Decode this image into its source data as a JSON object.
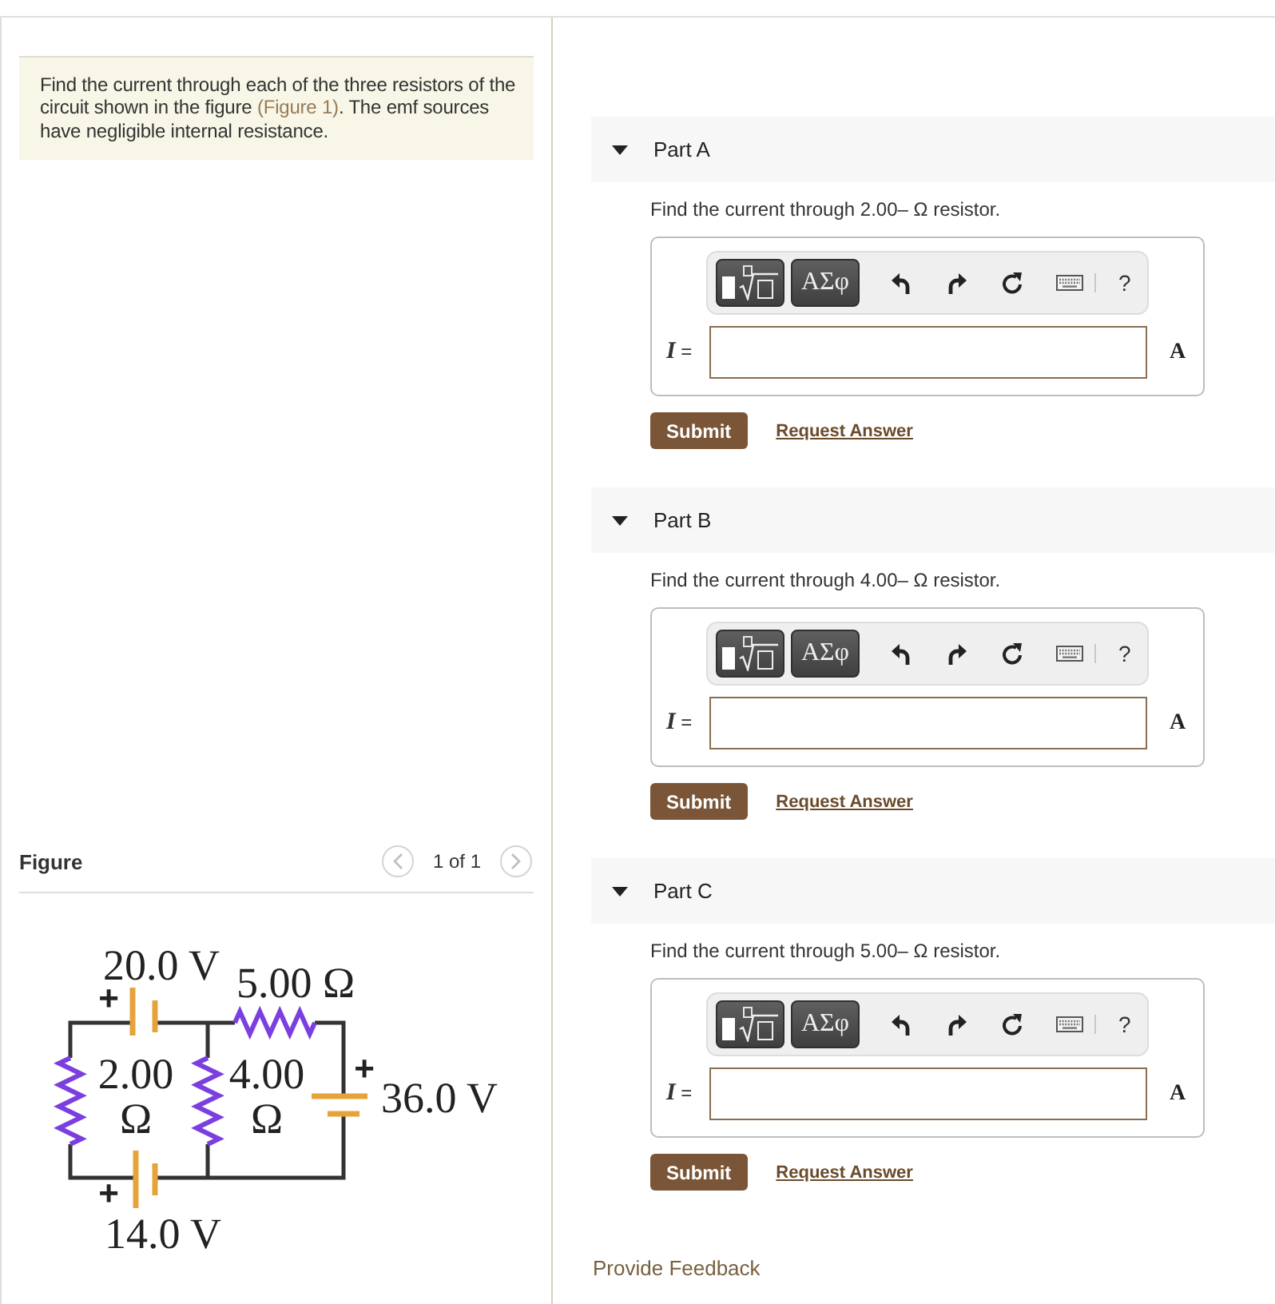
{
  "problem": {
    "text_before": "Find the current through each of the three resistors of the circuit shown in the figure ",
    "link": "(Figure 1)",
    "text_after": ". The emf sources have negligible internal resistance."
  },
  "figure": {
    "title": "Figure",
    "previous": {
      "disabled": true
    },
    "pager": "1 of 1",
    "next": {
      "disabled": true
    },
    "circuit": {
      "batteries": [
        {
          "label": "20.0 V",
          "polarity": "+"
        },
        {
          "label": "14.0 V",
          "polarity": "+"
        },
        {
          "label": "36.0 V",
          "polarity": "+"
        }
      ],
      "resistors": [
        {
          "label_lines": [
            "5.00 Ω"
          ]
        },
        {
          "label_lines": [
            "2.00",
            "Ω"
          ]
        },
        {
          "label_lines": [
            "4.00",
            "Ω"
          ]
        }
      ]
    }
  },
  "parts": [
    {
      "title": "Part A",
      "expanded": true,
      "prompt": "Find the current through 2.00– Ω resistor.",
      "toolbar": {
        "symbols": "ΑΣφ",
        "help": "?"
      },
      "variable": "*I* =",
      "unit": "A",
      "buttons": {
        "submit": "Submit",
        "request": "Request Answer"
      }
    },
    {
      "title": "Part B",
      "expanded": true,
      "prompt": "Find the current through 4.00– Ω resistor.",
      "toolbar": {
        "symbols": "ΑΣφ",
        "help": "?"
      },
      "variable": "*I* =",
      "unit": "A",
      "buttons": {
        "submit": "Submit",
        "request": "Request Answer"
      }
    },
    {
      "title": "Part C",
      "expanded": true,
      "prompt": "Find the current through 5.00– Ω resistor.",
      "toolbar": {
        "symbols": "ΑΣφ",
        "help": "?"
      },
      "variable": "*I* =",
      "unit": "A",
      "buttons": {
        "submit": "Submit",
        "request": "Request Answer"
      }
    }
  ],
  "footer": {
    "feedback": "Provide Feedback"
  }
}
